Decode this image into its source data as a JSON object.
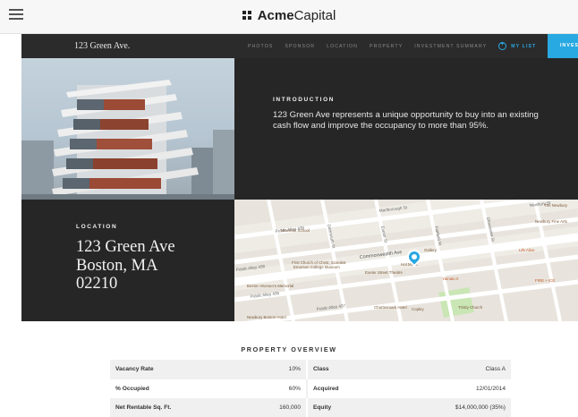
{
  "brand": {
    "name_bold": "Acme",
    "name_regular": "Capital"
  },
  "nav": {
    "title": "123 Green Ave.",
    "links": [
      "PHOTOS",
      "SPONSOR",
      "LOCATION",
      "PROPERTY",
      "INVESTMENT SUMMARY"
    ],
    "my_list": "MY LIST",
    "invest": "INVEST"
  },
  "intro": {
    "label": "INTRODUCTION",
    "text": "123 Green Ave represents a unique opportunity to buy into an existing cash flow and improve the occupancy to more than 95%."
  },
  "location": {
    "label": "LOCATION",
    "line1": "123 Green Ave",
    "line2": "Boston, MA",
    "line3": "02210"
  },
  "map": {
    "streets": [
      "Public Alley 439",
      "Newbury St",
      "Marlborough St",
      "Commonwealth Ave",
      "Public Alley 436",
      "Public Alley 437",
      "Public Alley 438",
      "Dartmouth St",
      "Exeter St",
      "Fairfield St",
      "Gloucester St"
    ],
    "places": [
      "Newman School",
      "First Church of Christ, Scientist",
      "Emerson College Museum",
      "Boston Women's Memorial",
      "Exeter Street Theatre",
      "Gallery",
      "Hot Mess",
      "Yamato II",
      "Life Alive",
      "Trinity Church",
      "Copley",
      "Chartesmark Hotel",
      "Newbury Boston Hotel",
      "Newbury Fine Arts",
      "FIRE + ICE",
      "The Newbury"
    ]
  },
  "overview": {
    "title": "PROPERTY OVERVIEW",
    "rows": [
      {
        "k1": "Vacancy Rate",
        "v1": "10%",
        "k2": "Class",
        "v2": "Class A"
      },
      {
        "k1": "% Occupied",
        "v1": "60%",
        "k2": "Acquired",
        "v2": "12/01/2014"
      },
      {
        "k1": "Net Rentable Sq. Ft.",
        "v1": "160,000",
        "k2": "Equity",
        "v2": "$14,000,000 (35%)"
      }
    ]
  },
  "colors": {
    "accent": "#29a9e1",
    "dark": "#262626",
    "park": "#c9e6b4"
  }
}
